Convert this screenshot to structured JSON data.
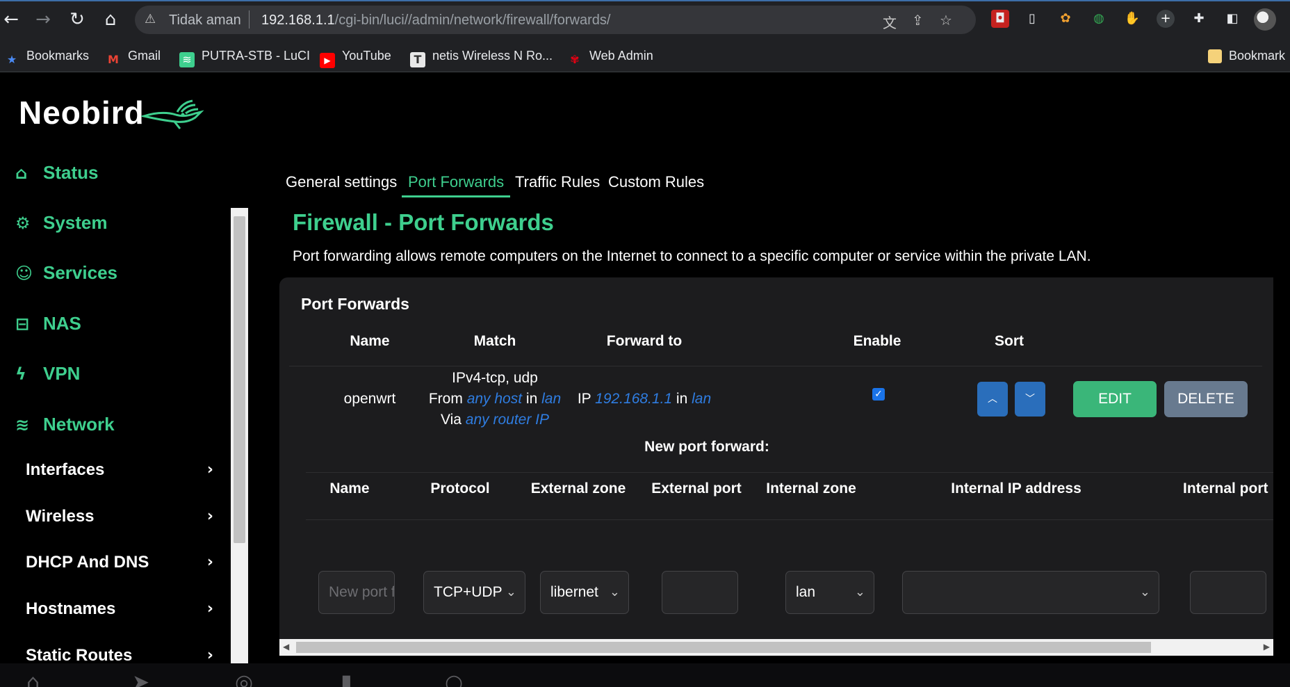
{
  "browser": {
    "security_label": "Tidak aman",
    "url_host": "192.168.1.1",
    "url_path": "/cgi-bin/luci//admin/network/firewall/forwards/",
    "back_icon": "arrow-left-icon",
    "forward_icon": "arrow-right-icon",
    "reload_icon": "reload-icon",
    "home_icon": "home-icon"
  },
  "bookmarks": {
    "items": [
      {
        "label": "Bookmarks",
        "icon": "star-icon"
      },
      {
        "label": "Gmail",
        "icon": "gmail-icon"
      },
      {
        "label": "PUTRA-STB - LuCI",
        "icon": "luci-icon"
      },
      {
        "label": "YouTube",
        "icon": "youtube-icon"
      },
      {
        "label": "netis Wireless N Ro...",
        "icon": "netis-icon"
      },
      {
        "label": "Web Admin",
        "icon": "huawei-icon"
      }
    ],
    "folder_label": "Bookmark"
  },
  "brand": {
    "name": "Neobird"
  },
  "sidebar": {
    "items": [
      {
        "label": "Status",
        "icon": "home-icon"
      },
      {
        "label": "System",
        "icon": "gear-icon"
      },
      {
        "label": "Services",
        "icon": "user-gear-icon"
      },
      {
        "label": "NAS",
        "icon": "drive-icon"
      },
      {
        "label": "VPN",
        "icon": "bolt-icon"
      },
      {
        "label": "Network",
        "icon": "wifi-icon"
      }
    ],
    "subitems": [
      {
        "label": "Interfaces"
      },
      {
        "label": "Wireless"
      },
      {
        "label": "DHCP And DNS"
      },
      {
        "label": "Hostnames"
      },
      {
        "label": "Static Routes"
      }
    ]
  },
  "tabs": [
    {
      "label": "General settings"
    },
    {
      "label": "Port Forwards",
      "active": true
    },
    {
      "label": "Traffic Rules"
    },
    {
      "label": "Custom Rules"
    }
  ],
  "page": {
    "title": "Firewall - Port Forwards",
    "description": "Port forwarding allows remote computers on the Internet to connect to a specific computer or service within the private LAN."
  },
  "forwards_table": {
    "title": "Port Forwards",
    "columns": [
      "Name",
      "Match",
      "Forward to",
      "Enable",
      "Sort"
    ],
    "rows": [
      {
        "name": "openwrt",
        "match_line1": "IPv4-tcp, udp",
        "match_from_prefix": "From",
        "match_from_host": "any host",
        "match_in": "in",
        "match_from_zone": "lan",
        "match_via_prefix": "Via",
        "match_via": "any router IP",
        "forward_prefix": "IP",
        "forward_ip": "192.168.1.1",
        "forward_in": "in",
        "forward_zone": "lan",
        "enabled": true,
        "edit_label": "EDIT",
        "delete_label": "DELETE"
      }
    ]
  },
  "new_forward": {
    "label": "New port forward:",
    "columns": [
      "Name",
      "Protocol",
      "External zone",
      "External port",
      "Internal zone",
      "Internal IP address",
      "Internal port"
    ],
    "name_placeholder": "New port forward",
    "protocol": "TCP+UDP",
    "external_zone": "libernet",
    "external_port": "",
    "internal_zone": "lan",
    "internal_ip": "",
    "internal_port": ""
  },
  "colors": {
    "accent": "#3ecf8e",
    "link": "#2f7de1",
    "sort_button": "#2a6ebb",
    "edit_button": "#3ab679",
    "delete_button": "#687a8f"
  }
}
